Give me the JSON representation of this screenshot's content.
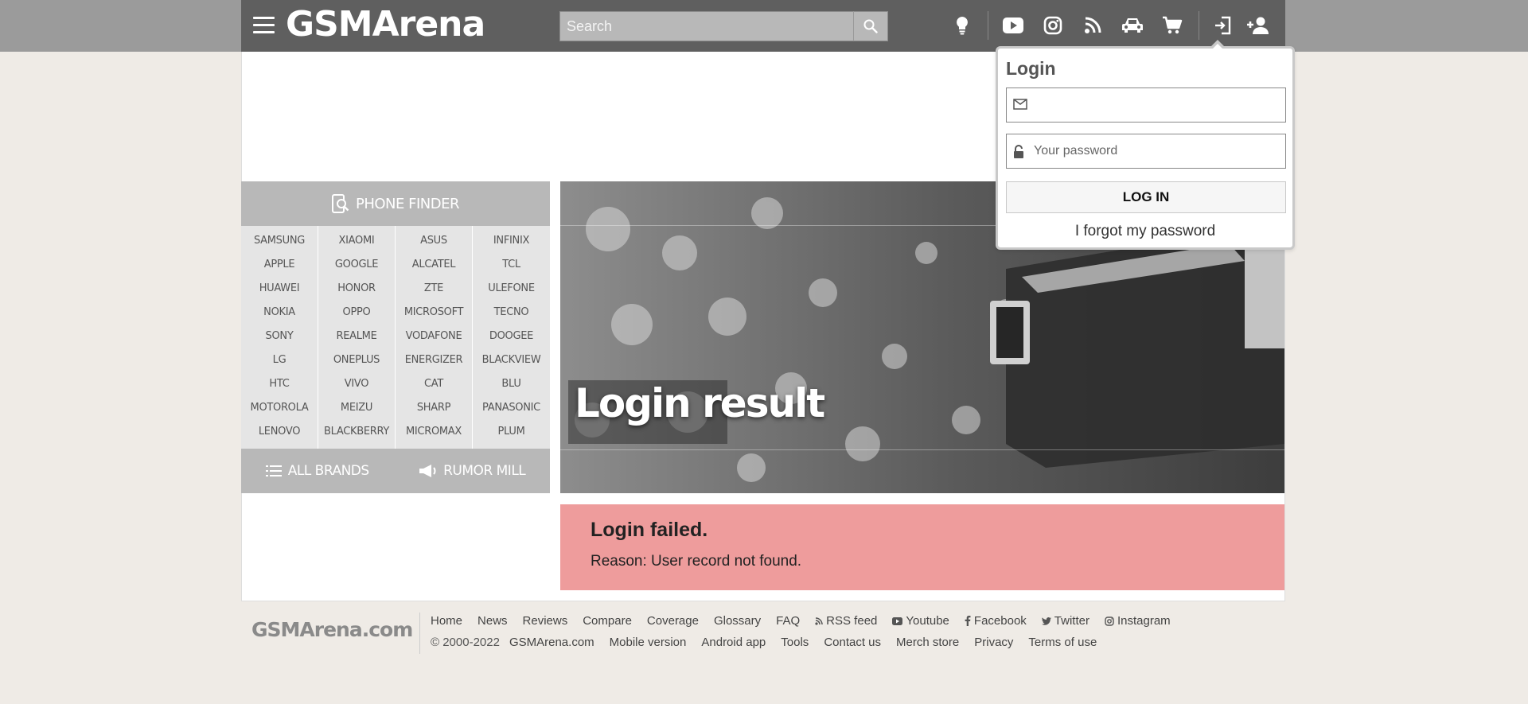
{
  "header": {
    "logo": "GSMArena",
    "search_placeholder": "Search",
    "icons": [
      "lightbulb-icon",
      "youtube-icon",
      "instagram-icon",
      "rss-icon",
      "car-icon",
      "cart-icon",
      "login-icon",
      "add-user-icon"
    ]
  },
  "phone_finder": {
    "title": "PHONE FINDER",
    "columns": [
      [
        "SAMSUNG",
        "APPLE",
        "HUAWEI",
        "NOKIA",
        "SONY",
        "LG",
        "HTC",
        "MOTOROLA",
        "LENOVO"
      ],
      [
        "XIAOMI",
        "GOOGLE",
        "HONOR",
        "OPPO",
        "REALME",
        "ONEPLUS",
        "VIVO",
        "MEIZU",
        "BLACKBERRY"
      ],
      [
        "ASUS",
        "ALCATEL",
        "ZTE",
        "MICROSOFT",
        "VODAFONE",
        "ENERGIZER",
        "CAT",
        "SHARP",
        "MICROMAX"
      ],
      [
        "INFINIX",
        "TCL",
        "ULEFONE",
        "TECNO",
        "DOOGEE",
        "BLACKVIEW",
        "BLU",
        "PANASONIC",
        "PLUM"
      ]
    ],
    "all_brands": "ALL BRANDS",
    "rumor_mill": "RUMOR MILL"
  },
  "hero": {
    "title": "Login result"
  },
  "result": {
    "title": "Login failed.",
    "reason": "Reason: User record not found."
  },
  "login_popup": {
    "title": "Login",
    "email_value": "",
    "password_placeholder": "Your password",
    "button": "LOG IN",
    "forgot": "I forgot my password"
  },
  "footer": {
    "logo": "GSMArena.com",
    "row1": [
      "Home",
      "News",
      "Reviews",
      "Compare",
      "Coverage",
      "Glossary",
      "FAQ"
    ],
    "row1_social": [
      "RSS feed",
      "Youtube",
      "Facebook",
      "Twitter",
      "Instagram"
    ],
    "copyright": "© 2000-2022",
    "row2": [
      "GSMArena.com",
      "Mobile version",
      "Android app",
      "Tools",
      "Contact us",
      "Merch store",
      "Privacy",
      "Terms of use"
    ]
  },
  "colors": {
    "topbar": "#5f5f5f",
    "error_panel": "#ee9c9c",
    "finder_header": "#b8b8b8"
  }
}
